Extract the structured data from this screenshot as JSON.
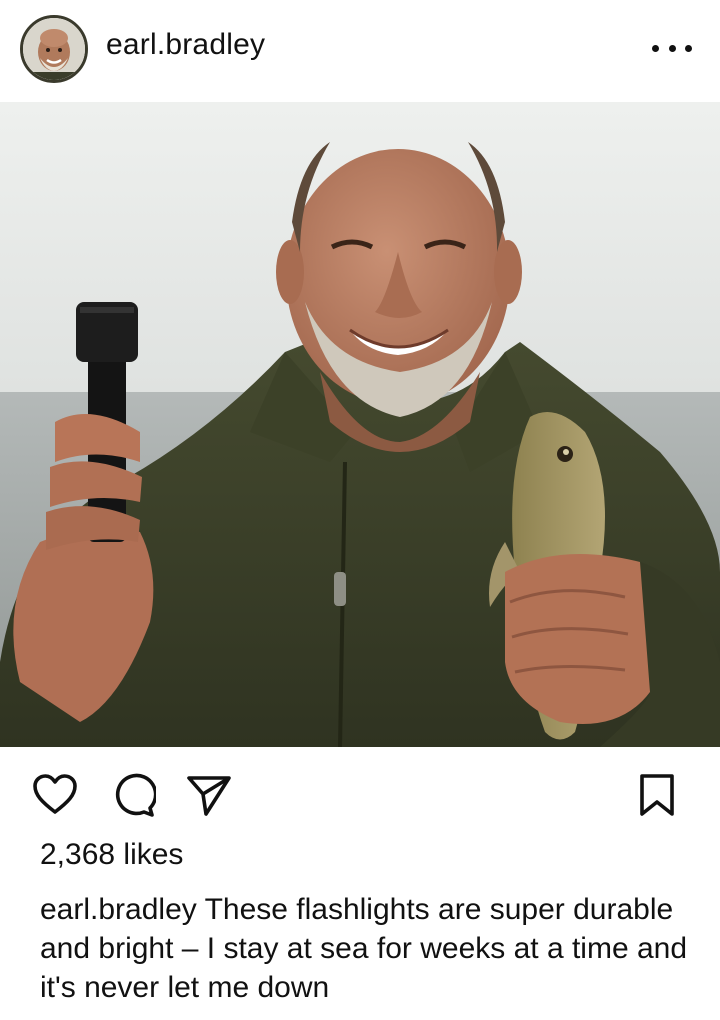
{
  "post": {
    "author": {
      "username": "earl.bradley",
      "avatar_icon": "profile-avatar"
    },
    "header": {
      "more_icon": "more-horizontal-icon"
    },
    "image": {
      "description_icon": "post-photo"
    },
    "actions": {
      "like_icon": "heart-icon",
      "comment_icon": "comment-bubble-icon",
      "share_icon": "paper-plane-icon",
      "save_icon": "bookmark-icon"
    },
    "likes_text": "2,368 likes",
    "caption": {
      "username": "earl.bradley",
      "text": "These flashlights are super durable and bright – I stay at sea for weeks at a time and it's never let me down"
    }
  },
  "colors": {
    "text": "#111111",
    "background": "#ffffff",
    "jacket": "#3b3f27",
    "sky": "#e6e8e6",
    "sea": "#9aa0a0"
  }
}
